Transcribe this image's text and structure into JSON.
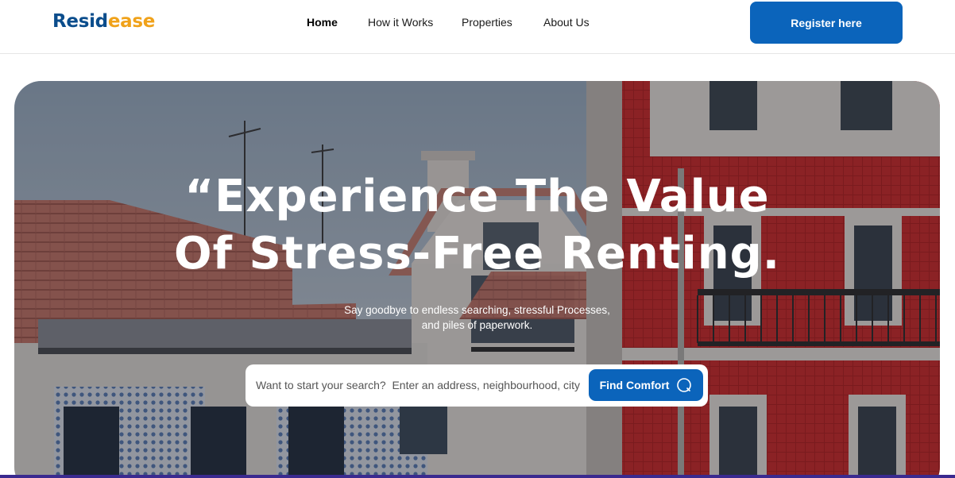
{
  "header": {
    "logo": {
      "part1": "Resid",
      "part2": "ease"
    },
    "nav": [
      {
        "label": "Home",
        "active": true
      },
      {
        "label": "How it Works",
        "active": false
      },
      {
        "label": "Properties",
        "active": false
      },
      {
        "label": "About Us",
        "active": false
      }
    ],
    "register_label": "Register here"
  },
  "hero": {
    "headline_line1": "“Experience The Value",
    "headline_line2": "Of Stress-Free Renting.",
    "subtext_line1": "Say goodbye to endless searching, stressful Processes,",
    "subtext_line2": "and piles of paperwork.",
    "search": {
      "placeholder": "Want to start your search?  Enter an address, neighbourhood, city or",
      "button_label": "Find Comfort",
      "button_icon": "search-icon"
    }
  },
  "colors": {
    "brand_blue": "#0b64bb",
    "logo_blue": "#0b4d8c",
    "logo_orange": "#f0a21a",
    "facade_red": "#d42a2a"
  }
}
